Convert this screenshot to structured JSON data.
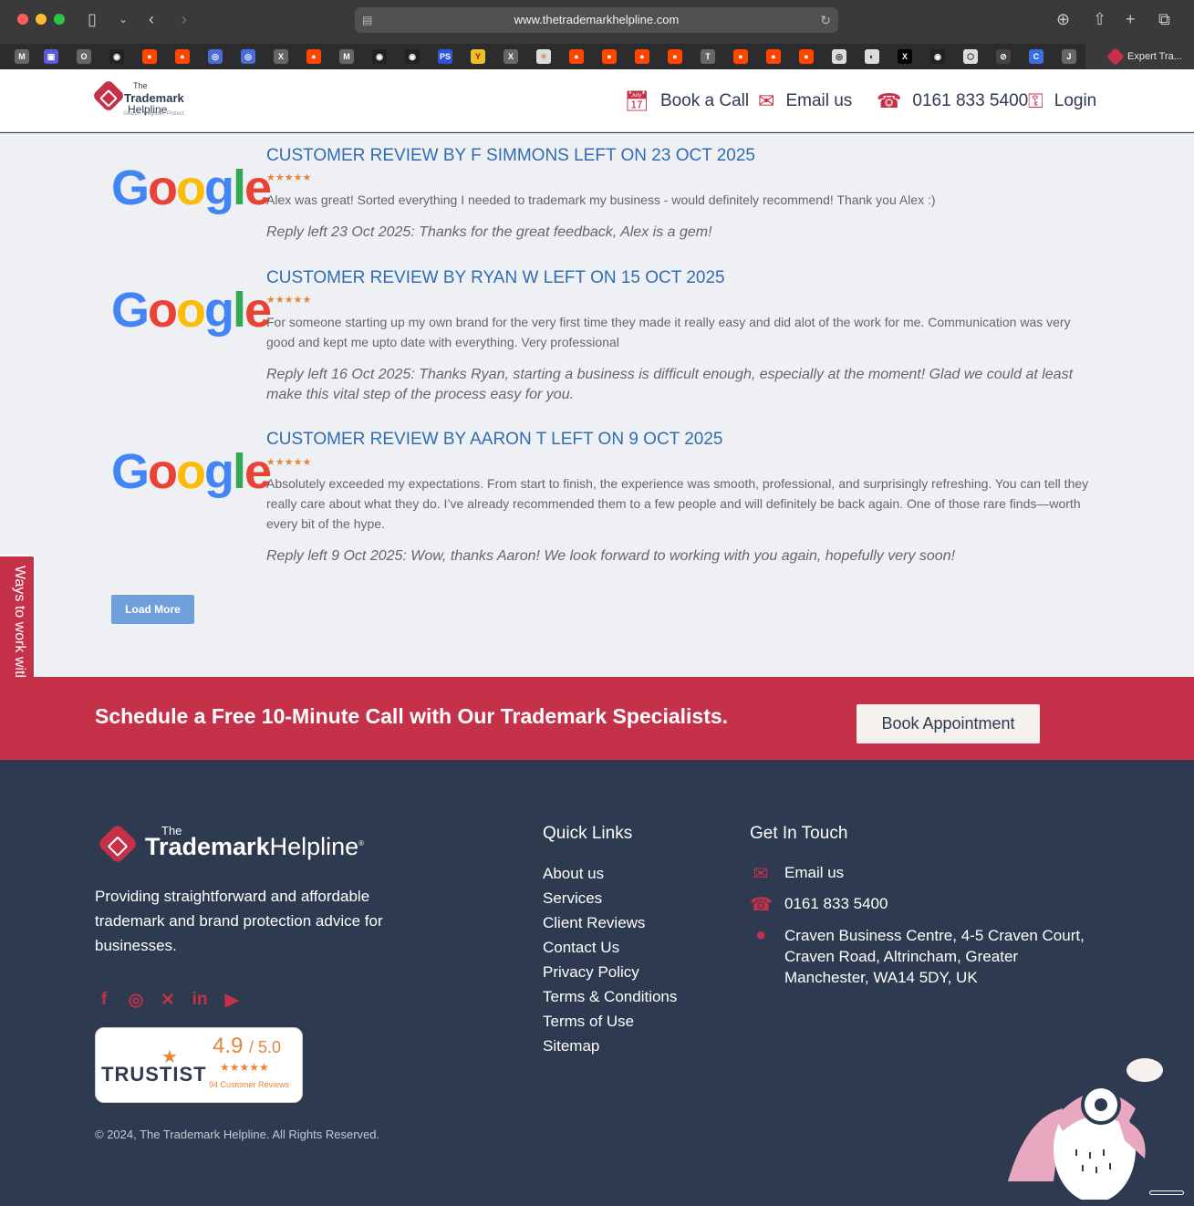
{
  "browser": {
    "url": "www.thetrademarkhelpline.com",
    "active_tab_title": "Expert Tra..."
  },
  "header": {
    "logo": {
      "the": "The",
      "trademark": "Trademark",
      "helpline": "Helpline",
      "tagline": "Search. Register. Protect."
    },
    "nav": [
      {
        "label": "Book a Call",
        "icon": "calendar-icon"
      },
      {
        "label": "Email us",
        "icon": "envelope-icon"
      },
      {
        "label": "0161 833 5400",
        "icon": "phone-icon"
      },
      {
        "label": "Login",
        "icon": "key-icon"
      }
    ]
  },
  "reviews": [
    {
      "title": "CUSTOMER REVIEW BY F SIMMONS LEFT ON 23 OCT 2025",
      "stars": "★★★★★",
      "text": "Alex was great! Sorted everything I needed to trademark my business - would definitely recommend! Thank you Alex :)",
      "reply": "Reply left 23 Oct 2025:  Thanks for the great feedback, Alex is a gem!"
    },
    {
      "title": "CUSTOMER REVIEW BY RYAN W LEFT ON 15 OCT 2025",
      "stars": "★★★★★",
      "text": "For someone starting up my own brand for the very first time they made it really easy and did alot of the work for me. Communication was very good and kept me upto date with everything. Very professional",
      "reply": "Reply left 16 Oct 2025:  Thanks Ryan, starting a business is difficult enough, especially at the moment! Glad we could at least make this vital step of the process easy for you."
    },
    {
      "title": "CUSTOMER REVIEW BY AARON T LEFT ON 9 OCT 2025",
      "stars": "★★★★★",
      "text": "Absolutely exceeded my expectations. From start to finish, the experience was smooth, professional, and surprisingly refreshing. You can tell they really care about what they do. I’ve already recommended them to a few people and will definitely be back again. One of those rare finds—worth every bit of the hype.",
      "reply": "Reply left 9 Oct 2025:  Wow, thanks Aaron! We look forward to working with you again, hopefully very soon!"
    }
  ],
  "load_more": "Load More",
  "side_tab": "Ways to work with us",
  "cta": {
    "text": "Schedule a Free 10-Minute Call with Our Trademark Specialists.",
    "button": "Book Appointment"
  },
  "footer": {
    "logo": {
      "the": "The",
      "trademark": "Trademark",
      "helpline": "Helpline"
    },
    "about": "Providing straightforward and affordable trademark and brand protection advice for businesses.",
    "social": [
      "facebook-icon",
      "instagram-icon",
      "x-icon",
      "linkedin-icon",
      "youtube-icon"
    ],
    "trustist": {
      "name": "TRUSTIST",
      "score": "4.9",
      "out_of": "/ 5.0",
      "stars": "★★★★★",
      "count": "94 Customer Reviews"
    },
    "copyright": "© 2024, The Trademark Helpline. All Rights Reserved.",
    "quick_links_title": "Quick Links",
    "quick_links": [
      "About us",
      "Services",
      "Client Reviews",
      "Contact Us",
      "Privacy Policy",
      "Terms & Conditions",
      "Terms of Use",
      "Sitemap"
    ],
    "contact_title": "Get In Touch",
    "contact": {
      "email": "Email us",
      "phone": "0161 833 5400",
      "address": "Craven Business Centre, 4-5 Craven Court, Craven Road, Altrincham, Greater Manchester, WA14 5DY, UK"
    }
  },
  "colors": {
    "brand_red": "#c6314a",
    "navy": "#2e3a4f",
    "review_blue": "#2f6cb4",
    "star_orange": "#e8843a"
  }
}
